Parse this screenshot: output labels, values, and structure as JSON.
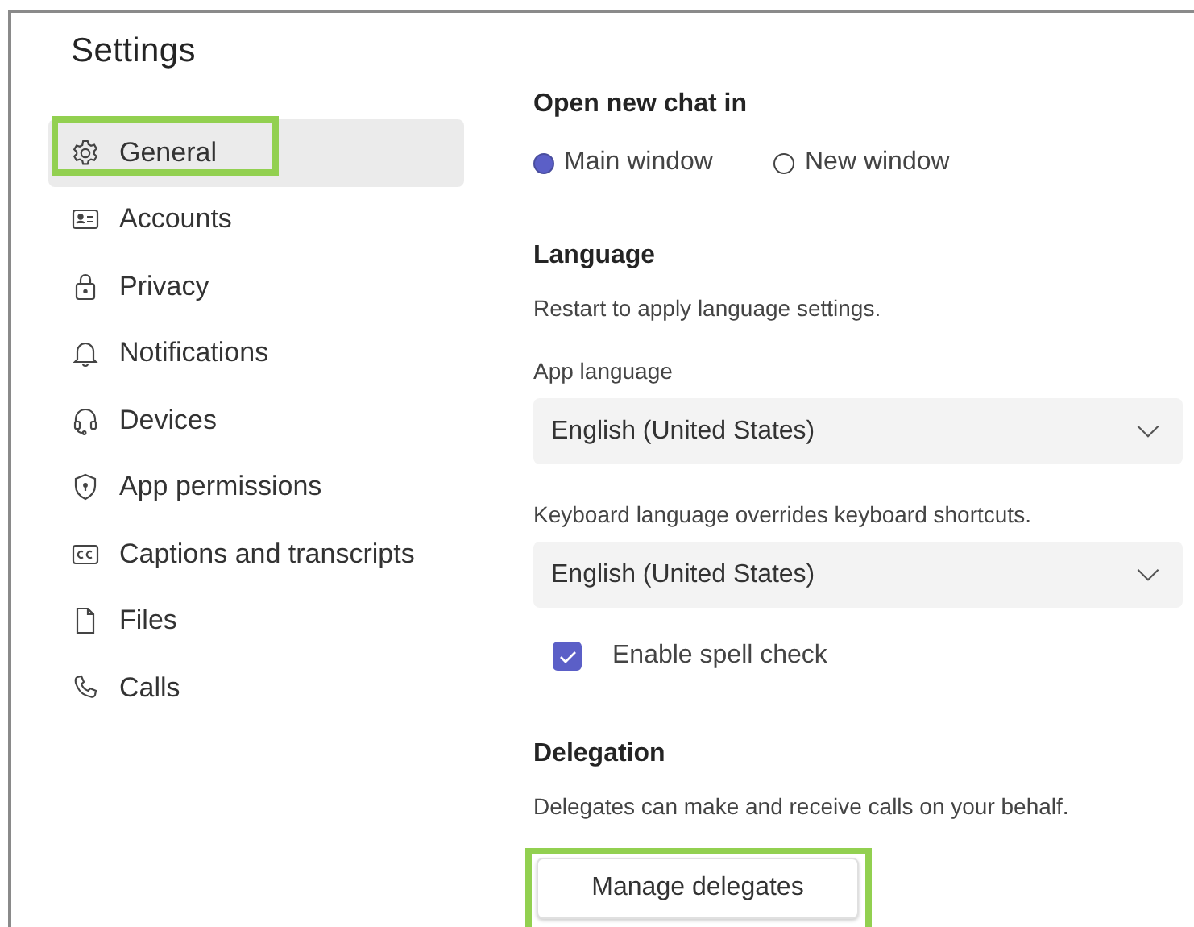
{
  "title": "Settings",
  "nav": [
    {
      "label": "General",
      "selected": true,
      "highlighted": true
    },
    {
      "label": "Accounts",
      "selected": false,
      "highlighted": false
    },
    {
      "label": "Privacy",
      "selected": false,
      "highlighted": false
    },
    {
      "label": "Notifications",
      "selected": false,
      "highlighted": false
    },
    {
      "label": "Devices",
      "selected": false,
      "highlighted": false
    },
    {
      "label": "App permissions",
      "selected": false,
      "highlighted": false
    },
    {
      "label": "Captions and transcripts",
      "selected": false,
      "highlighted": false
    },
    {
      "label": "Files",
      "selected": false,
      "highlighted": false
    },
    {
      "label": "Calls",
      "selected": false,
      "highlighted": false
    }
  ],
  "open_chat": {
    "heading": "Open new chat in",
    "options": [
      {
        "label": "Main window",
        "selected": true
      },
      {
        "label": "New window",
        "selected": false
      }
    ]
  },
  "language": {
    "heading": "Language",
    "note": "Restart to apply language settings.",
    "app_language_label": "App language",
    "app_language": "English (United States)",
    "keyboard_label": "Keyboard language overrides keyboard shortcuts.",
    "keyboard_language": "English (United States)",
    "spell_check": {
      "label": "Enable spell check",
      "checked": true
    }
  },
  "delegation": {
    "heading": "Delegation",
    "note": "Delegates can make and receive calls on your behalf.",
    "button": {
      "label": "Manage delegates",
      "highlighted": true
    }
  }
}
